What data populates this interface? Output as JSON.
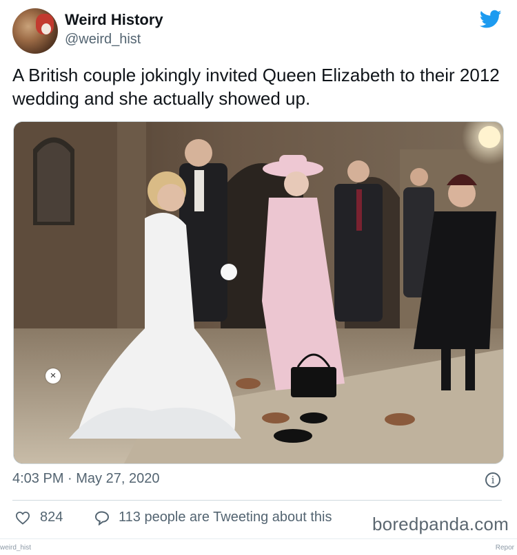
{
  "account": {
    "name": "Weird History",
    "handle": "@weird_hist"
  },
  "tweet": {
    "text": "A British couple jokingly invited Queen Elizabeth to their 2012 wedding and she actually showed up.",
    "timestamp": "4:03 PM · May 27, 2020",
    "likes": "824",
    "replies_text": "113 people are Tweeting about this"
  },
  "photo": {
    "close_glyph": "×"
  },
  "info_glyph": "i",
  "watermark": "boredpanda.com",
  "footer": {
    "left": "weird_hist",
    "right": "Repor"
  },
  "colors": {
    "twitter_blue": "#1d9bf0",
    "secondary_text": "#536471"
  },
  "icons": [
    "twitter-bird-icon",
    "heart-icon",
    "reply-bubble-icon",
    "info-icon",
    "close-icon"
  ]
}
